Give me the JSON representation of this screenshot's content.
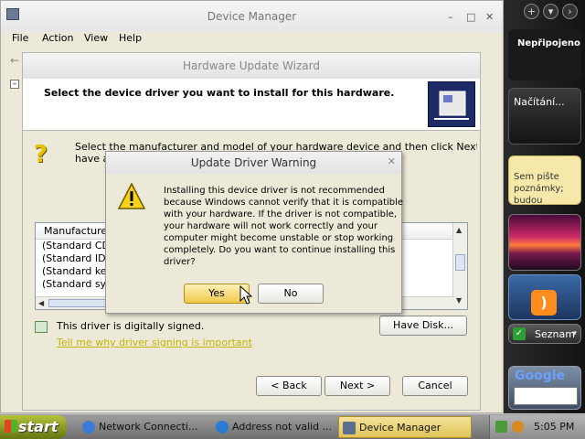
{
  "device_manager": {
    "title": "Device Manager",
    "controls": {
      "minimize": "–",
      "maximize": "□",
      "close": "✕"
    },
    "menu": [
      "File",
      "Action",
      "View",
      "Help"
    ],
    "tree_toggle": "–"
  },
  "wizard": {
    "title": "Hardware Update Wizard",
    "heading": "Select the device driver you want to install for this hardware.",
    "instructions_line1": "Select the manufacturer and model of your hardware device and then click Next. If you",
    "instructions_line2": "have a",
    "list": {
      "header": "Manufacturer",
      "rows": [
        "(Standard CD-R",
        "(Standard IDE",
        "(Standard keyb",
        "(Standard syste"
      ]
    },
    "signed_text": "This driver is digitally signed.",
    "signing_link": "Tell me why driver signing is important",
    "have_disk": "Have Disk...",
    "back": "< Back",
    "next": "Next >",
    "cancel": "Cancel"
  },
  "warning": {
    "title": "Update Driver Warning",
    "close": "✕",
    "lines": [
      "Installing this device driver is not recommended",
      "because Windows cannot verify that it is compatible",
      "with your hardware.  If the driver is not compatible,",
      "your hardware will not work correctly and your",
      "computer might become unstable or stop working",
      "completely.  Do you want to continue installing this",
      "driver?"
    ],
    "yes": "Yes",
    "no": "No"
  },
  "taskbar": {
    "start": "start",
    "tasks": [
      "Network Connecti...",
      "Address not valid ...",
      "Device Manager"
    ],
    "clock": "5:05 PM"
  },
  "sidebar": {
    "buttons": [
      "+",
      "▾",
      "›"
    ],
    "network_status": "Nepřipojeno",
    "loading": "Načítání...",
    "notes": [
      "Sem pište",
      "poznámky;",
      "budou"
    ],
    "seznam": "Seznam",
    "google": "Google"
  },
  "colors": {
    "window_bg": "#ece9d8",
    "taskbar_active": "#f1d97e",
    "link": "#c7b300",
    "start_green": "#7e8f1a"
  }
}
